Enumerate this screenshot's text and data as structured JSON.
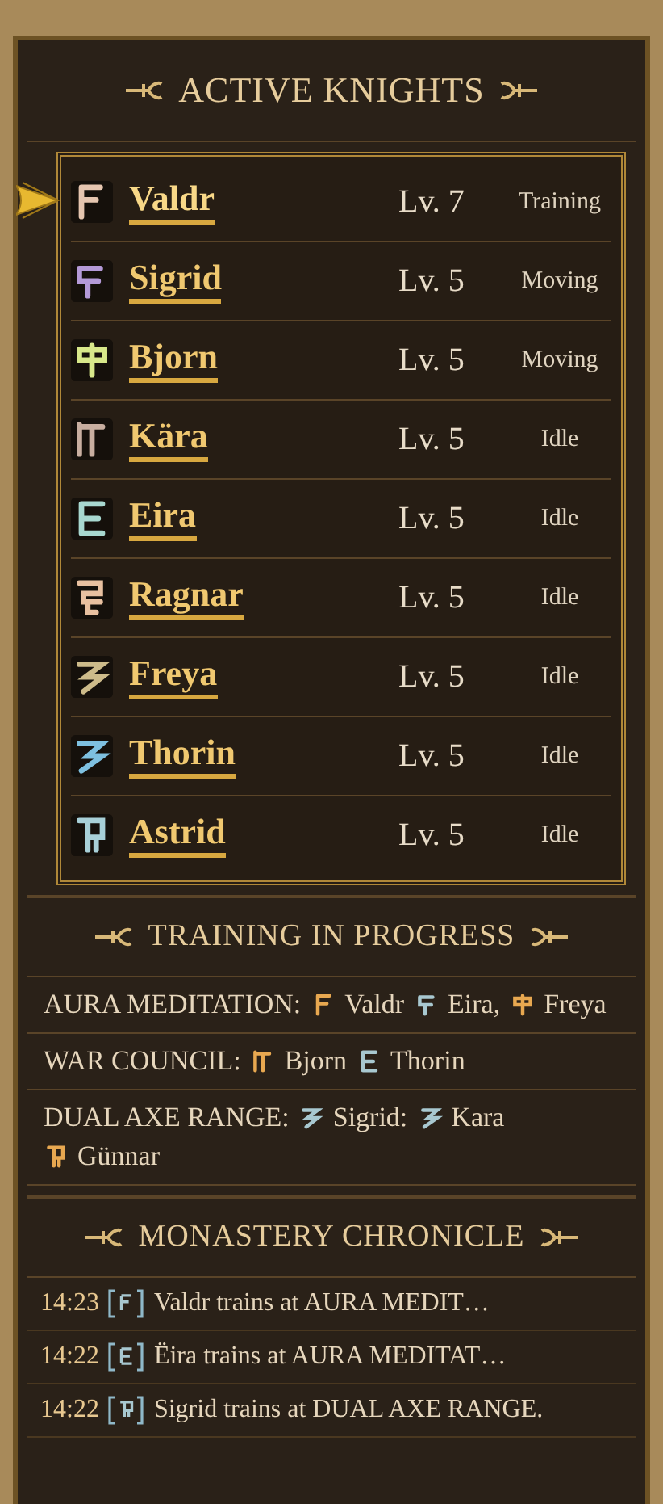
{
  "knights_panel": {
    "title": "ACTIVE KNIGHTS",
    "knights": [
      {
        "name": "Valdr",
        "level": "Lv. 7",
        "status": "Training",
        "color": "#e6c6b0",
        "selected": true
      },
      {
        "name": "Sigrid",
        "level": "Lv. 5",
        "status": "Moving",
        "color": "#b49ad8",
        "selected": false
      },
      {
        "name": "Bjorn",
        "level": "Lv. 5",
        "status": "Moving",
        "color": "#d8e88a",
        "selected": false
      },
      {
        "name": "Kära",
        "level": "Lv. 5",
        "status": "Idle",
        "color": "#c8aea0",
        "selected": false
      },
      {
        "name": "Eira",
        "level": "Lv. 5",
        "status": "Idle",
        "color": "#a8d8d0",
        "selected": false
      },
      {
        "name": "Ragnar",
        "level": "Lv. 5",
        "status": "Idle",
        "color": "#e8c0a0",
        "selected": false
      },
      {
        "name": "Freya",
        "level": "Lv. 5",
        "status": "Idle",
        "color": "#cdbb8a",
        "selected": false
      },
      {
        "name": "Thorin",
        "level": "Lv. 5",
        "status": "Idle",
        "color": "#7ec0e0",
        "selected": false
      },
      {
        "name": "Astrid",
        "level": "Lv. 5",
        "status": "Idle",
        "color": "#a8d0d8",
        "selected": false
      }
    ]
  },
  "training_panel": {
    "title": "TRAINING IN PROGRESS",
    "sessions": [
      {
        "activity": "AURA MEDITATION:",
        "participants": [
          {
            "name": "Valdr",
            "color": "#e8a850"
          },
          {
            "name": "Eira,",
            "color": "#a8c8d0"
          },
          {
            "name": "Freya",
            "color": "#e8a850"
          }
        ]
      },
      {
        "activity": "WAR COUNCIL:",
        "participants": [
          {
            "name": "Bjorn",
            "color": "#e8a850"
          },
          {
            "name": "Thorin",
            "color": "#a8c8d0"
          }
        ]
      },
      {
        "activity": "DUAL AXE RANGE:",
        "participants": [
          {
            "name": "Sigrid:",
            "color": "#a8c8d0"
          },
          {
            "name": "Kara",
            "color": "#a8c8d0"
          },
          {
            "name": "Günnar",
            "color": "#e8a850"
          }
        ]
      }
    ]
  },
  "chronicle_panel": {
    "title": "MONASTERY CHRONICLE",
    "entries": [
      {
        "time": "14:23",
        "message": "Valdr trains at AURA MEDIT…"
      },
      {
        "time": "14:22",
        "message": "Ëira trains at AURA MEDITAT…"
      },
      {
        "time": "14:22",
        "message": "Sigrid trains at DUAL AXE RANGE."
      }
    ]
  }
}
